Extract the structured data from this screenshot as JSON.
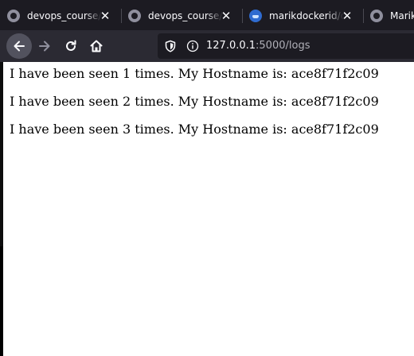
{
  "browser": {
    "tabs": [
      {
        "title": "devops_course/",
        "icon": "github-icon"
      },
      {
        "title": "devops_course/",
        "icon": "github-icon"
      },
      {
        "title": "marikdockerid/d",
        "icon": "docker-icon"
      },
      {
        "title": "Marik",
        "icon": "github-icon"
      }
    ],
    "close_glyph": "✕",
    "url": {
      "host": "127.0.0.1",
      "rest": ":5000/logs"
    }
  },
  "page": {
    "lines": [
      "I have been seen 1 times. My Hostname is: ace8f71f2c09",
      "I have been seen 2 times. My Hostname is: ace8f71f2c09",
      "I have been seen 3 times. My Hostname is: ace8f71f2c09"
    ]
  },
  "colors": {
    "tabbar_bg": "#1c1b22",
    "toolbar_bg": "#2b2a33",
    "page_bg": "#ffffff",
    "text": "#000000"
  }
}
